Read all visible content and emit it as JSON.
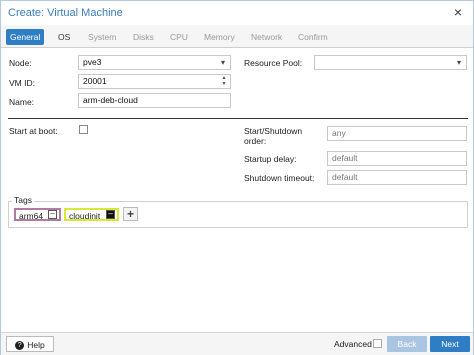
{
  "window": {
    "title": "Create: Virtual Machine"
  },
  "tabs": [
    {
      "label": "General",
      "state": "active"
    },
    {
      "label": "OS",
      "state": "enabled"
    },
    {
      "label": "System",
      "state": "disabled"
    },
    {
      "label": "Disks",
      "state": "disabled"
    },
    {
      "label": "CPU",
      "state": "disabled"
    },
    {
      "label": "Memory",
      "state": "disabled"
    },
    {
      "label": "Network",
      "state": "disabled"
    },
    {
      "label": "Confirm",
      "state": "disabled"
    }
  ],
  "form": {
    "node_label": "Node:",
    "node_value": "pve3",
    "vmid_label": "VM ID:",
    "vmid_value": "20001",
    "name_label": "Name:",
    "name_value": "arm-deb-cloud",
    "resource_pool_label": "Resource Pool:",
    "resource_pool_value": "",
    "start_at_boot_label": "Start at boot:",
    "start_at_boot_checked": false,
    "startup_order_label_line1": "Start/Shutdown",
    "startup_order_label_line2": "order:",
    "startup_order_placeholder": "any",
    "startup_delay_label": "Startup delay:",
    "startup_delay_placeholder": "default",
    "shutdown_timeout_label": "Shutdown timeout:",
    "shutdown_timeout_placeholder": "default"
  },
  "tags": {
    "legend": "Tags",
    "items": [
      {
        "label": "arm64",
        "color": "#b07aa1"
      },
      {
        "label": "cloudinit",
        "color": "#d7e936"
      }
    ],
    "add_label": "+"
  },
  "footer": {
    "help_label": "Help",
    "advanced_label": "Advanced",
    "back_label": "Back",
    "next_label": "Next"
  },
  "colors": {
    "accent": "#2f7dc4",
    "title": "#3a7dc0"
  }
}
